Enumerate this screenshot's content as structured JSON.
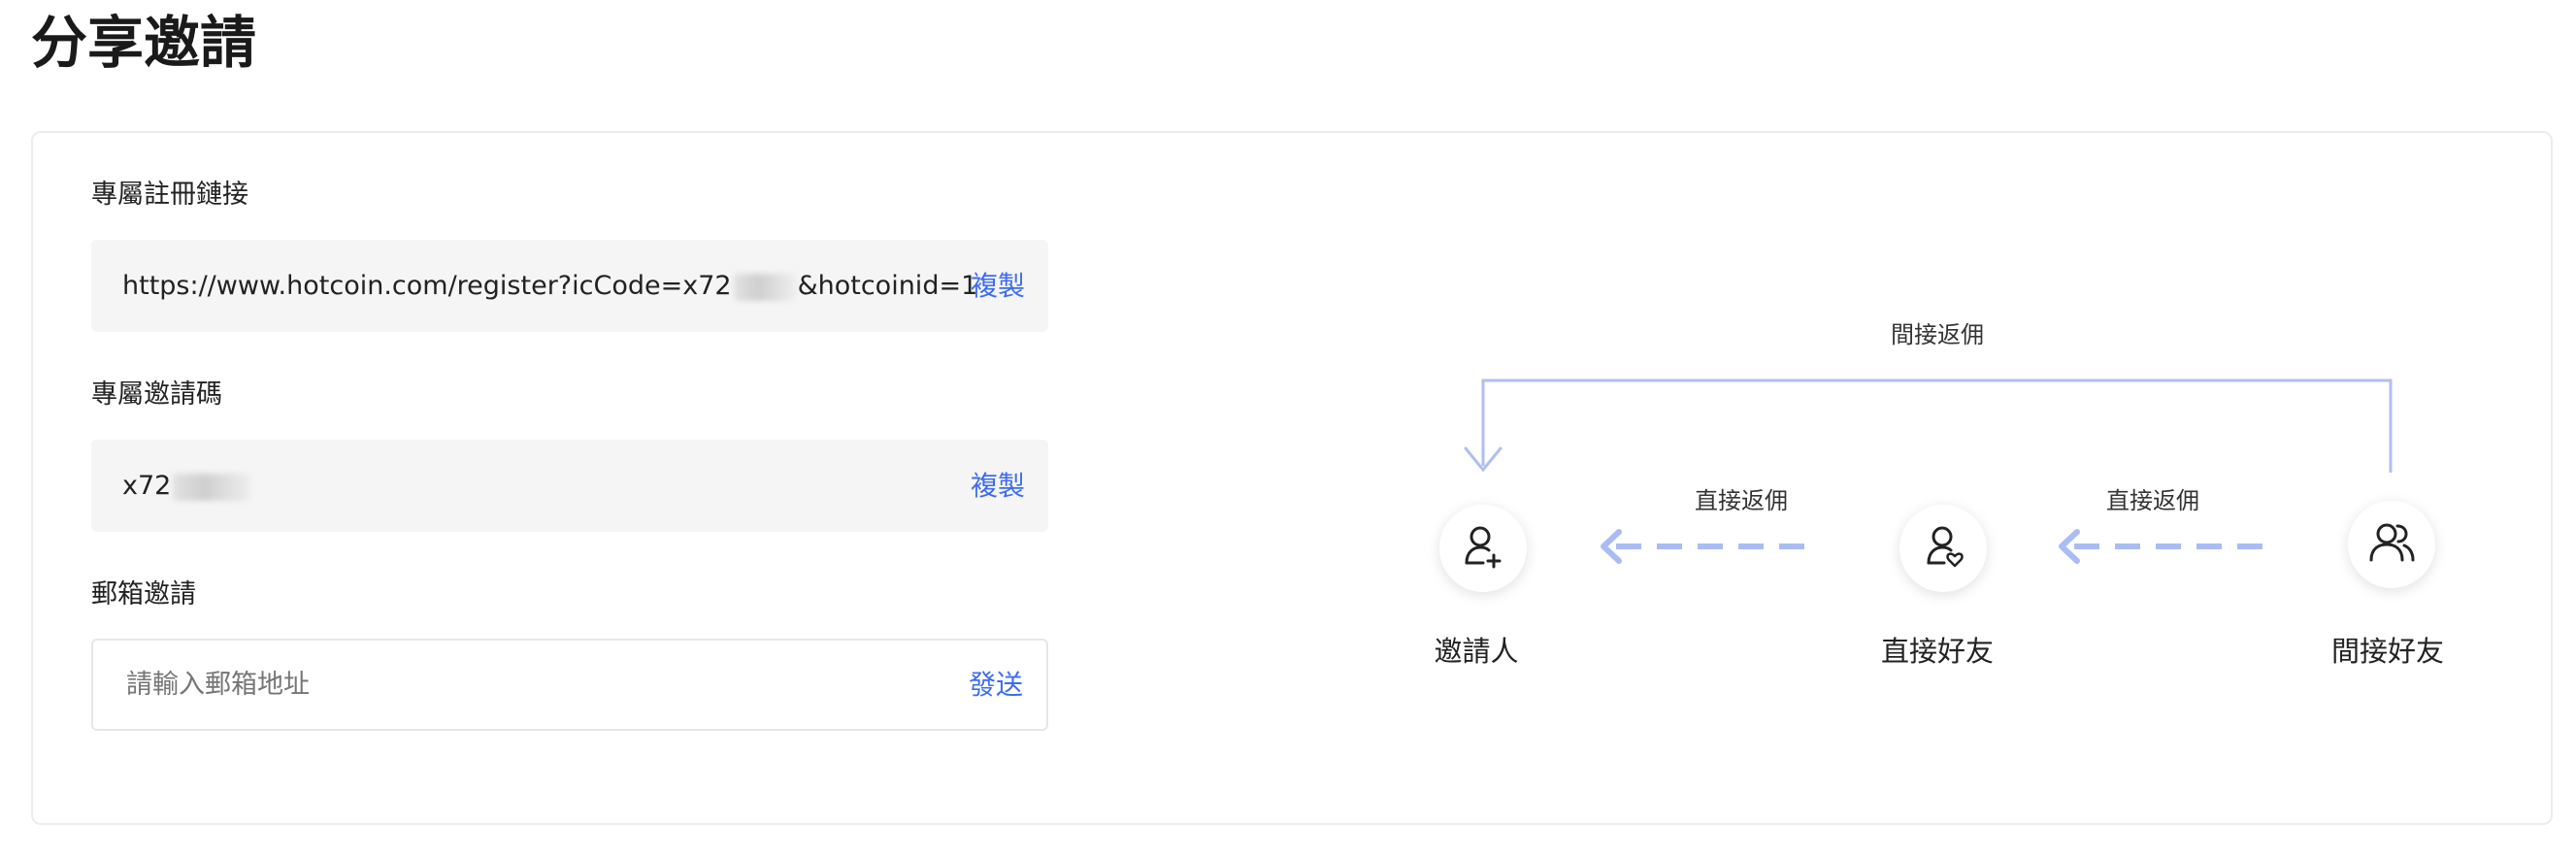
{
  "page": {
    "title": "分享邀請"
  },
  "form": {
    "link": {
      "label": "專屬註冊鏈接",
      "value_prefix": "https://www.hotcoin.com/register?icCode=x72",
      "value_suffix": "&hotcoinid=1",
      "action": "複製"
    },
    "code": {
      "label": "專屬邀請碼",
      "value_prefix": "x72",
      "action": "複製"
    },
    "email": {
      "label": "郵箱邀請",
      "placeholder": "請輸入郵箱地址",
      "action": "發送"
    }
  },
  "diagram": {
    "indirect_label": "間接返佣",
    "direct_label_left": "直接返佣",
    "direct_label_right": "直接返佣",
    "nodes": [
      {
        "label": "邀請人",
        "icon": "user-plus-icon"
      },
      {
        "label": "直接好友",
        "icon": "user-heart-icon"
      },
      {
        "label": "間接好友",
        "icon": "users-icon"
      }
    ],
    "line_color": "#aebff2",
    "arrow_color": "#a9bcf4"
  },
  "colors": {
    "accent": "#3d6cf0"
  }
}
